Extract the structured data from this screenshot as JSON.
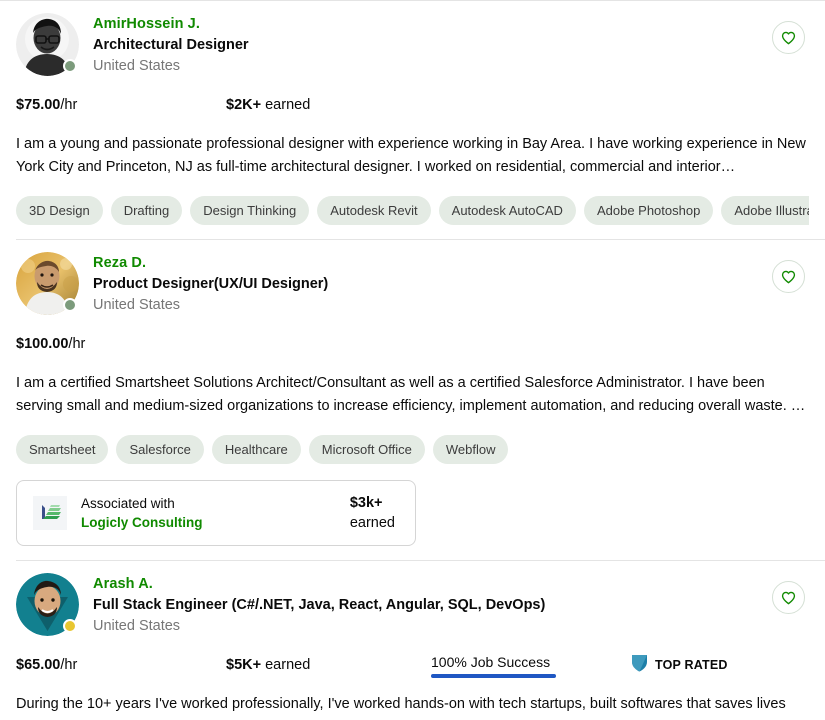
{
  "colors": {
    "brand_green": "#108a00",
    "tag_bg": "#e4ebe4",
    "job_success_bar": "#1f57c3",
    "toprated_shield": "#1d7fa8",
    "online_dot": "#7c9b7c",
    "away_dot": "#e8c630",
    "muted_text": "#767676"
  },
  "freelancers": [
    {
      "name": "AmirHossein J.",
      "title": "Architectural Designer",
      "location": "United States",
      "rate": "$75.00",
      "rate_unit": "/hr",
      "earned": "$2K+",
      "earned_label": "earned",
      "job_success": null,
      "top_rated": null,
      "status": "online",
      "description": "I am a young and passionate professional designer with experience working in Bay Area. I have working experience in New York City and Princeton, NJ as full-time architectural designer. I worked on residential, commercial and interior…",
      "skills": [
        "3D Design",
        "Drafting",
        "Design Thinking",
        "Autodesk Revit",
        "Autodesk AutoCAD",
        "Adobe Photoshop",
        "Adobe Illustrator"
      ],
      "skills_more_icon": "chevron-right-icon",
      "favorite_icon": "heart-icon",
      "agency": null
    },
    {
      "name": "Reza D.",
      "title": "Product Designer(UX/UI Designer)",
      "location": "United States",
      "rate": "$100.00",
      "rate_unit": "/hr",
      "earned": null,
      "earned_label": null,
      "job_success": null,
      "top_rated": null,
      "status": "online",
      "description": "I am a certified Smartsheet Solutions Architect/Consultant as well as a certified Salesforce Administrator. I have been serving small and medium-sized organizations to increase efficiency, implement automation, and reducing overall waste. …",
      "skills": [
        "Smartsheet",
        "Salesforce",
        "Healthcare",
        "Microsoft Office",
        "Webflow"
      ],
      "skills_more_icon": null,
      "favorite_icon": "heart-icon",
      "agency": {
        "associated_label": "Associated with",
        "agency_name": "Logicly Consulting",
        "earned_amount": "$3k+",
        "earned_word": "earned",
        "logo_icon": "logicly-logo-icon"
      }
    },
    {
      "name": "Arash A.",
      "title": "Full Stack Engineer (C#/.NET, Java, React, Angular, SQL, DevOps)",
      "location": "United States",
      "rate": "$65.00",
      "rate_unit": "/hr",
      "earned": "$5K+",
      "earned_label": "earned",
      "job_success": "100% Job Success",
      "top_rated": "TOP RATED",
      "status": "away",
      "description": "During the 10+ years I've worked professionally, I've worked hands-on with tech startups, built softwares that saves lives",
      "skills": [],
      "skills_more_icon": null,
      "favorite_icon": "heart-icon",
      "agency": null
    }
  ]
}
